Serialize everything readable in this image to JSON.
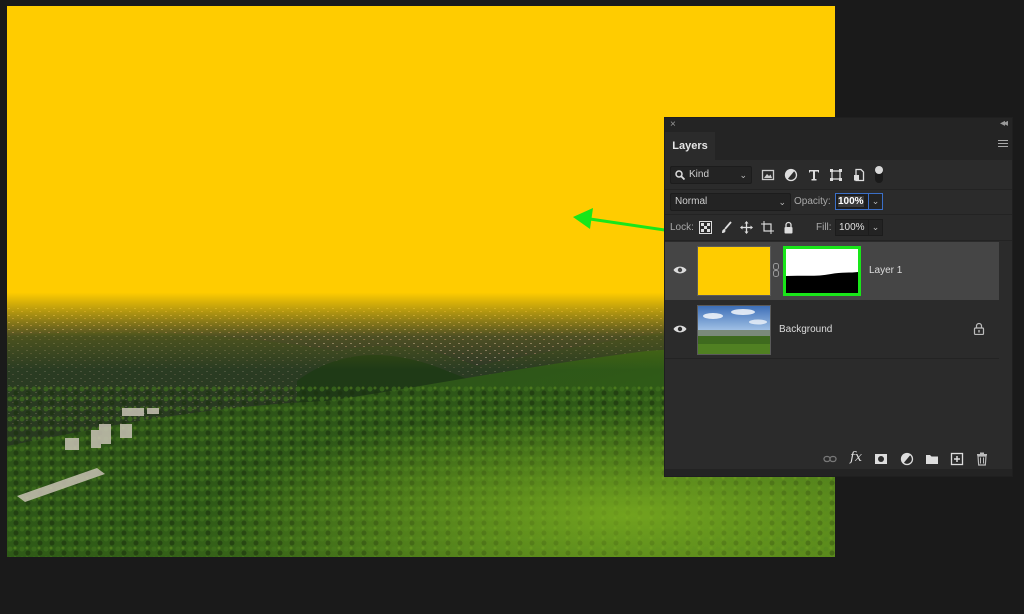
{
  "colors": {
    "fill_layer": "#ffcc00",
    "highlight": "#19e619",
    "focus_ring": "#3b6fc7",
    "workspace_bg": "#1a1a1a",
    "panel_bg": "#2b2b2b"
  },
  "document": {
    "description": "Aerial landscape of forested hills and town with a yellow solid fill layer masked to the sky area"
  },
  "panel": {
    "close_icon": "×",
    "collapse_icon": "◂◂",
    "tab": "Layers",
    "menu_icon": "hamburger-menu-icon",
    "filter": {
      "kind_label": "Kind",
      "icons": [
        "image-filter-icon",
        "adjustment-filter-icon",
        "type-filter-icon",
        "shape-filter-icon",
        "smart-object-filter-icon",
        "filter-toggle"
      ]
    },
    "blend_mode": "Normal",
    "opacity_label": "Opacity:",
    "opacity_value": "100%",
    "lock_label": "Lock:",
    "lock_icons": [
      "lock-transparent-pixels-icon",
      "lock-image-pixels-icon",
      "lock-position-icon",
      "lock-artboard-icon",
      "lock-all-icon"
    ],
    "fill_label": "Fill:",
    "fill_value": "100%",
    "layers": [
      {
        "name": "Layer 1",
        "visible": true,
        "selected": true,
        "has_mask": true,
        "thumbnail": "yellow fill"
      },
      {
        "name": "Background",
        "visible": true,
        "selected": false,
        "locked": true,
        "thumbnail": "landscape photo"
      }
    ],
    "footer_icons": [
      "link-layers-icon",
      "fx-icon",
      "add-mask-icon",
      "adjustment-layer-icon",
      "new-group-icon",
      "new-layer-icon",
      "trash-icon"
    ],
    "footer_fx_label": "fx"
  },
  "annotation": {
    "arrow": "green arrow pointing from layer mask thumbnail to canvas"
  }
}
